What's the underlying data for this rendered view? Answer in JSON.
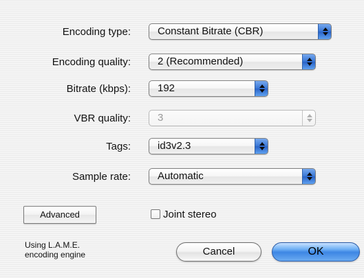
{
  "form": {
    "rows": [
      {
        "label": "Encoding type:",
        "value": "Constant Bitrate (CBR)",
        "enabled": true
      },
      {
        "label": "Encoding quality:",
        "value": "2 (Recommended)",
        "enabled": true
      },
      {
        "label": "Bitrate (kbps):",
        "value": "192",
        "enabled": true
      },
      {
        "label": "VBR quality:",
        "value": "3",
        "enabled": false
      },
      {
        "label": "Tags:",
        "value": "id3v2.3",
        "enabled": true
      },
      {
        "label": "Sample rate:",
        "value": "Automatic",
        "enabled": true
      }
    ]
  },
  "options": {
    "advanced_label": "Advanced",
    "joint_stereo_label": "Joint stereo",
    "joint_stereo_checked": false
  },
  "footer": {
    "engine_text": "Using L.A.M.E.\nencoding engine",
    "cancel_label": "Cancel",
    "ok_label": "OK"
  },
  "theme": {
    "default_button_color": "#4a90e2",
    "accent_blue": "#3a78d6",
    "disabled_text": "#9a9a9a"
  }
}
